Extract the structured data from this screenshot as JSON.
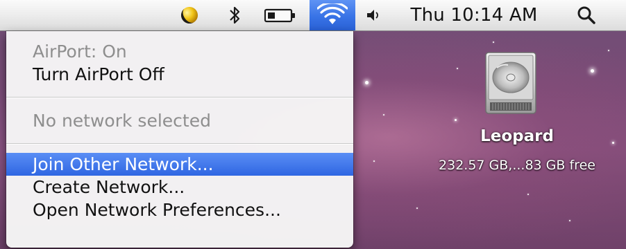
{
  "menubar": {
    "status_items": [
      {
        "name": "moon-icon"
      },
      {
        "name": "bluetooth-icon"
      },
      {
        "name": "battery-icon"
      },
      {
        "name": "airport-wifi-icon",
        "active": true
      },
      {
        "name": "volume-icon"
      }
    ],
    "clock": "Thu 10:14 AM",
    "spotlight_icon": "magnifier-icon"
  },
  "airport_menu": {
    "status": "AirPort: On",
    "toggle_label": "Turn AirPort Off",
    "network_status": "No network selected",
    "join_other": "Join Other Network...",
    "create_network": "Create Network...",
    "open_preferences": "Open Network Preferences..."
  },
  "desktop": {
    "drive": {
      "name": "Leopard",
      "info": "232.57 GB,...83 GB free",
      "icon": "hard-drive-icon"
    }
  },
  "colors": {
    "highlight": "#3a72e8",
    "menubar": "#e8e8e8",
    "desktop": "#7a4c78"
  }
}
